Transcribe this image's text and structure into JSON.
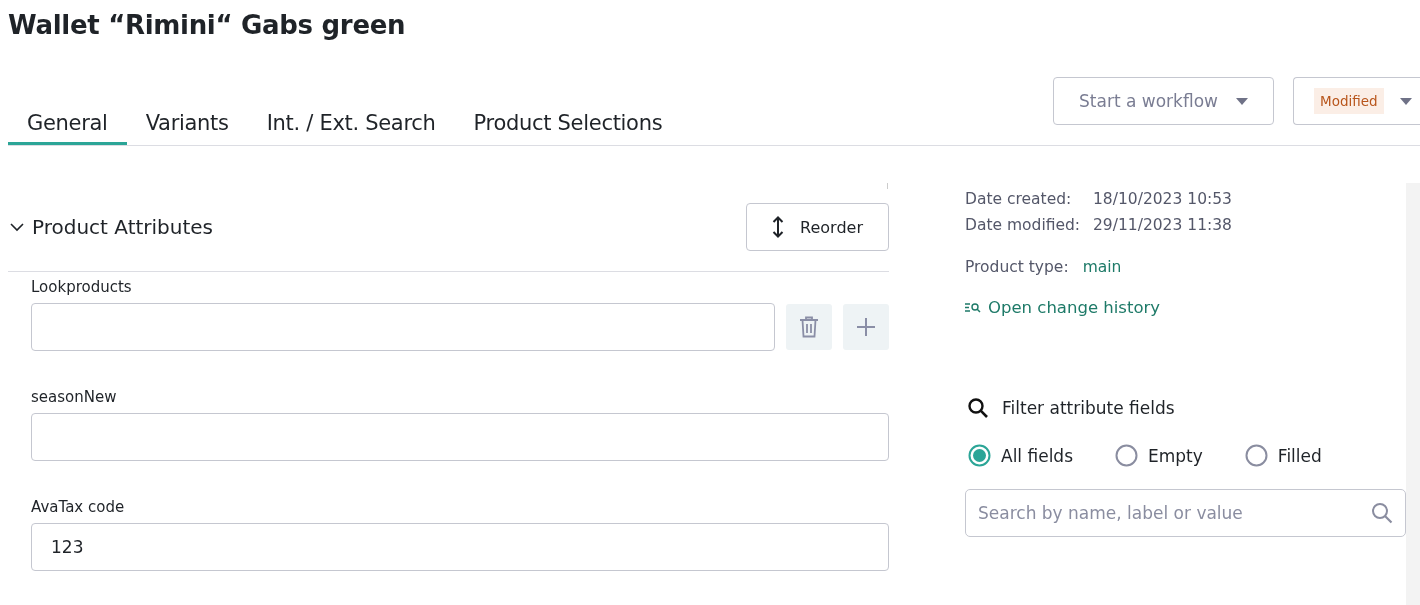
{
  "title": "Wallet “Rimini“ Gabs green",
  "tabs": [
    {
      "label": "General",
      "selected": true
    },
    {
      "label": "Variants",
      "selected": false
    },
    {
      "label": "Int. / Ext. Search",
      "selected": false
    },
    {
      "label": "Product Selections",
      "selected": false
    }
  ],
  "workflow_button": {
    "label": "Start a workflow"
  },
  "status_button": {
    "label": "Modified"
  },
  "section": {
    "title": "Product Attributes",
    "expanded": true,
    "reorder_label": "Reorder",
    "fields": [
      {
        "label": "Lookproducts",
        "kind": "multi"
      },
      {
        "label": "seasonNew",
        "kind": "text"
      },
      {
        "label": "AvaTax code",
        "kind": "text",
        "value": "123"
      }
    ]
  },
  "info": {
    "rows": [
      {
        "label": "Date created:",
        "value": "18/10/2023 10:53"
      },
      {
        "label": "Date modified:",
        "value": "29/11/2023 11:38"
      }
    ],
    "product_type_label": "Product type:",
    "product_type": "main",
    "history_link": "Open change history"
  },
  "filter": {
    "title": "Filter attribute fields",
    "options": [
      {
        "label": "All fields",
        "selected": true
      },
      {
        "label": "Empty",
        "selected": false
      },
      {
        "label": "Filled",
        "selected": false
      }
    ],
    "search": {
      "placeholder": "Search by name, label or value"
    }
  }
}
